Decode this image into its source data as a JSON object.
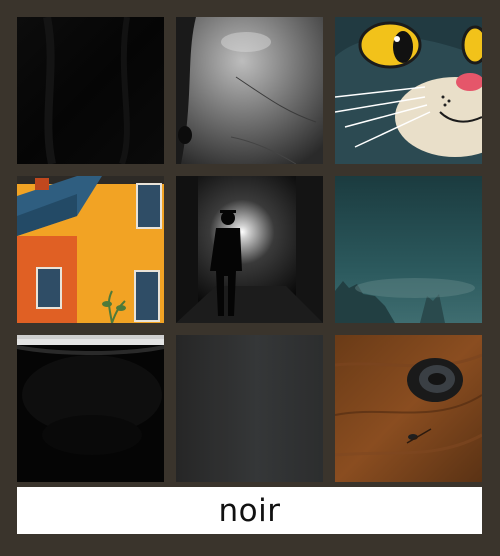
{
  "captcha": {
    "label": "noir",
    "tiles": [
      {
        "icon": "dark-fabric-image"
      },
      {
        "icon": "grayscale-face-closeup-image"
      },
      {
        "icon": "cartoon-cat-image"
      },
      {
        "icon": "orange-house-image"
      },
      {
        "icon": "noir-silhouette-alley-image"
      },
      {
        "icon": "teal-misty-landscape-image"
      },
      {
        "icon": "dark-bowl-image"
      },
      {
        "icon": "gray-gradient-image"
      },
      {
        "icon": "wood-surface-closeup-image"
      }
    ]
  }
}
